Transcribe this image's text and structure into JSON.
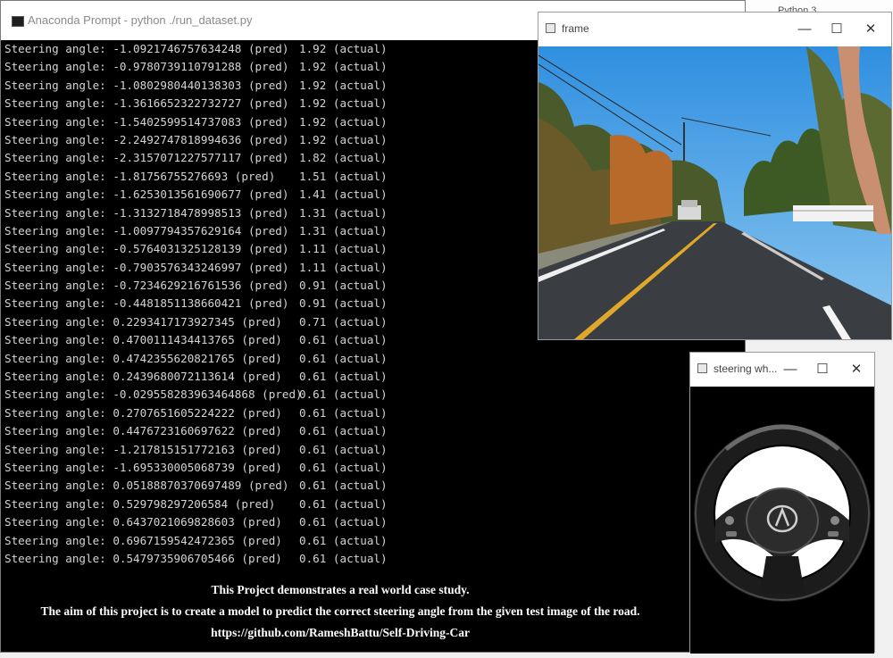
{
  "background_window": {
    "label": "Python 3"
  },
  "console": {
    "title": "Anaconda Prompt - python  ./run_dataset.py",
    "lines": [
      {
        "pred": "Steering angle: -1.0921746757634248 (pred)",
        "actual": "1.92 (actual)"
      },
      {
        "pred": "Steering angle: -0.9780739110791288 (pred)",
        "actual": "1.92 (actual)"
      },
      {
        "pred": "Steering angle: -1.0802980440138303 (pred)",
        "actual": "1.92 (actual)"
      },
      {
        "pred": "Steering angle: -1.3616652322732727 (pred)",
        "actual": "1.92 (actual)"
      },
      {
        "pred": "Steering angle: -1.5402599514737083 (pred)",
        "actual": "1.92 (actual)"
      },
      {
        "pred": "Steering angle: -2.2492747818994636 (pred)",
        "actual": "1.92 (actual)"
      },
      {
        "pred": "Steering angle: -2.3157071227577117 (pred)",
        "actual": "1.82 (actual)"
      },
      {
        "pred": "Steering angle: -1.81756755276693 (pred)",
        "actual": "1.51 (actual)"
      },
      {
        "pred": "Steering angle: -1.6253013561690677 (pred)",
        "actual": "1.41 (actual)"
      },
      {
        "pred": "Steering angle: -1.3132718478998513 (pred)",
        "actual": "1.31 (actual)"
      },
      {
        "pred": "Steering angle: -1.0097794357629164 (pred)",
        "actual": "1.31 (actual)"
      },
      {
        "pred": "Steering angle: -0.5764031325128139 (pred)",
        "actual": "1.11 (actual)"
      },
      {
        "pred": "Steering angle: -0.7903576343246997 (pred)",
        "actual": "1.11 (actual)"
      },
      {
        "pred": "Steering angle: -0.7234629216761536 (pred)",
        "actual": "0.91 (actual)"
      },
      {
        "pred": "Steering angle: -0.4481851138660421 (pred)",
        "actual": "0.91 (actual)"
      },
      {
        "pred": "Steering angle: 0.2293417173927345 (pred)",
        "actual": "0.71 (actual)"
      },
      {
        "pred": "Steering angle: 0.4700111434413765 (pred)",
        "actual": "0.61 (actual)"
      },
      {
        "pred": "Steering angle: 0.4742355620821765 (pred)",
        "actual": "0.61 (actual)"
      },
      {
        "pred": "Steering angle: 0.2439680072113614 (pred)",
        "actual": "0.61 (actual)"
      },
      {
        "pred": "Steering angle: -0.029558283963464868 (pred)",
        "actual": "0.61 (actual)"
      },
      {
        "pred": "Steering angle: 0.2707651605224222 (pred)",
        "actual": "0.61 (actual)"
      },
      {
        "pred": "Steering angle: 0.4476723160697622 (pred)",
        "actual": "0.61 (actual)"
      },
      {
        "pred": "Steering angle: -1.217815151772163 (pred)",
        "actual": "0.61 (actual)"
      },
      {
        "pred": "Steering angle: -1.695330005068739 (pred)",
        "actual": "0.61 (actual)"
      },
      {
        "pred": "Steering angle: 0.05188870370697489 (pred)",
        "actual": "0.61 (actual)"
      },
      {
        "pred": "Steering angle: 0.529798297206584 (pred)",
        "actual": "0.61 (actual)"
      },
      {
        "pred": "Steering angle: 0.6437021069828603 (pred)",
        "actual": "0.61 (actual)"
      },
      {
        "pred": "Steering angle: 0.6967159542472365 (pred)",
        "actual": "0.61 (actual)"
      },
      {
        "pred": "Steering angle: 0.5479735906705466 (pred)",
        "actual": "0.61 (actual)"
      }
    ],
    "caption": [
      "This Project demonstrates a real world case study.",
      "The aim of this project is to create a model to predict the correct steering angle from the given test image of the road.",
      "https://github.com/RameshBattu/Self-Driving-Car"
    ]
  },
  "frame_window": {
    "title": "frame"
  },
  "steering_window": {
    "title": "steering wh..."
  },
  "window_controls": {
    "minimize": "—",
    "maximize": "☐",
    "close": "✕"
  },
  "colors": {
    "console_bg": "#000000",
    "console_text": "#d4d4d4",
    "sky": "#4aa3e8",
    "road": "#3a3d42",
    "lane_yellow": "#e0a82a"
  },
  "icons": {
    "console": "terminal-icon",
    "frame": "window-icon",
    "steering": "window-icon",
    "wheel_logo": "acura-logo"
  }
}
